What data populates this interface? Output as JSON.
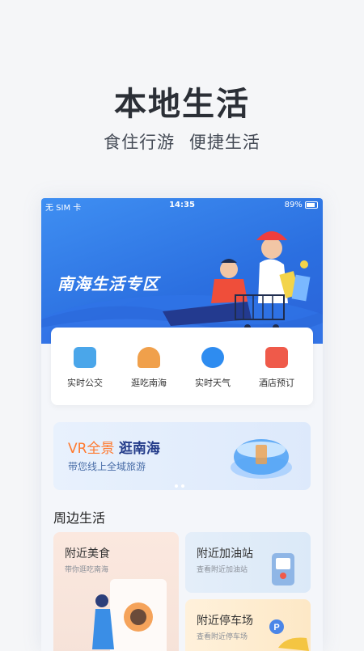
{
  "hero": {
    "title": "本地生活",
    "subtitle": "食住行游  便捷生活"
  },
  "status_bar": {
    "carrier": "无 SIM 卡",
    "time": "14:35",
    "battery": "89%"
  },
  "banner": {
    "title": "南海生活专区"
  },
  "quick_actions": [
    {
      "label": "实时公交",
      "icon": "bus-icon",
      "color": "#4aa6ea"
    },
    {
      "label": "逛吃南海",
      "icon": "dish-icon",
      "color": "#f0a04b"
    },
    {
      "label": "实时天气",
      "icon": "weather-drop-icon",
      "color": "#2e8cf0"
    },
    {
      "label": "酒店预订",
      "icon": "hotel-icon",
      "color": "#ef5a4a"
    }
  ],
  "vr_card": {
    "title_part1": "VR全景",
    "title_part2": "逛南海",
    "subtitle": "带您线上全域旅游"
  },
  "section": {
    "title": "周边生活"
  },
  "life_cards": {
    "food": {
      "title": "附近美食",
      "subtitle": "带你逛吃南海"
    },
    "gas": {
      "title": "附近加油站",
      "subtitle": "查看附近加油站"
    },
    "parking": {
      "title": "附近停车场",
      "subtitle": "查看附近停车场"
    }
  },
  "colors": {
    "banner_blue": "#2b6fe0",
    "accent_orange": "#ff7a2f",
    "heading_dark": "#243c8a"
  }
}
